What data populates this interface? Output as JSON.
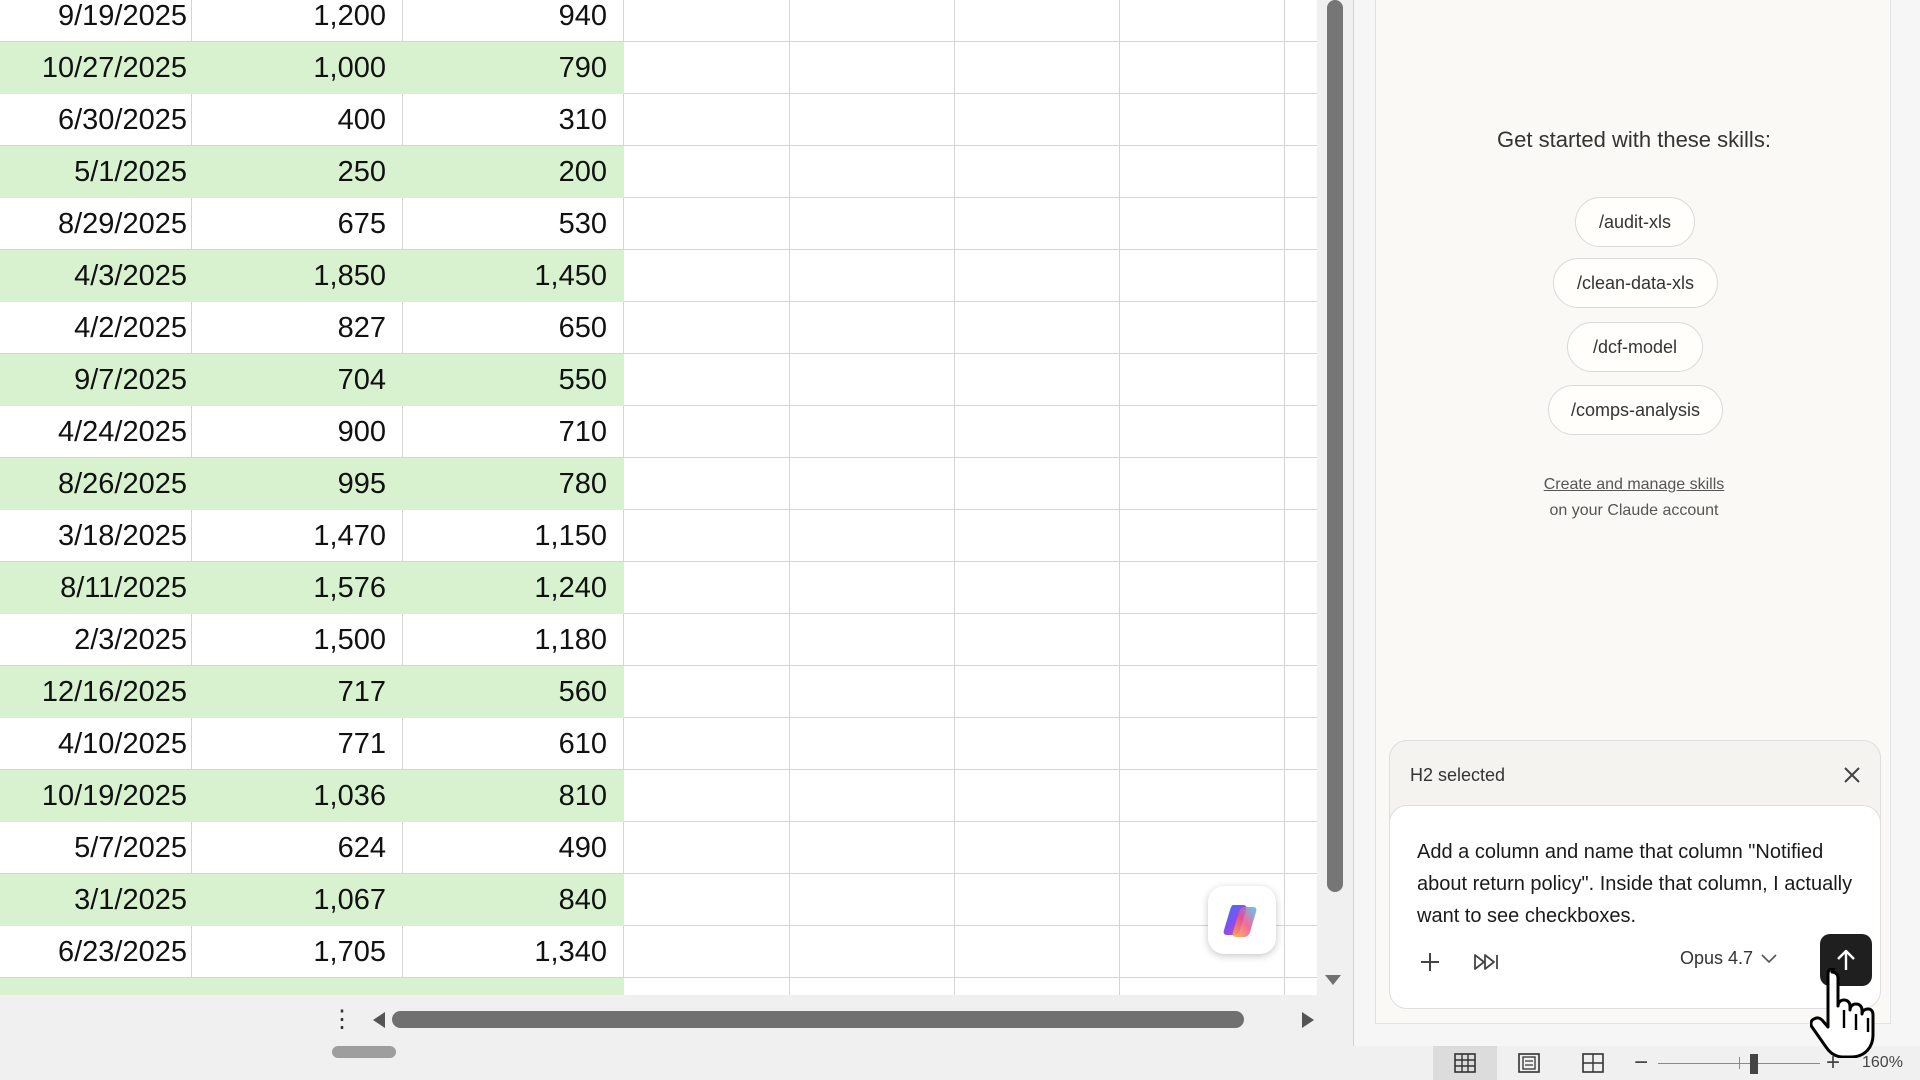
{
  "sheet": {
    "rows": [
      {
        "date": "9/19/2025",
        "col2": "1,200",
        "col3": "940",
        "green": false
      },
      {
        "date": "10/27/2025",
        "col2": "1,000",
        "col3": "790",
        "green": true
      },
      {
        "date": "6/30/2025",
        "col2": "400",
        "col3": "310",
        "green": false
      },
      {
        "date": "5/1/2025",
        "col2": "250",
        "col3": "200",
        "green": true
      },
      {
        "date": "8/29/2025",
        "col2": "675",
        "col3": "530",
        "green": false
      },
      {
        "date": "4/3/2025",
        "col2": "1,850",
        "col3": "1,450",
        "green": true
      },
      {
        "date": "4/2/2025",
        "col2": "827",
        "col3": "650",
        "green": false
      },
      {
        "date": "9/7/2025",
        "col2": "704",
        "col3": "550",
        "green": true
      },
      {
        "date": "4/24/2025",
        "col2": "900",
        "col3": "710",
        "green": false
      },
      {
        "date": "8/26/2025",
        "col2": "995",
        "col3": "780",
        "green": true
      },
      {
        "date": "3/18/2025",
        "col2": "1,470",
        "col3": "1,150",
        "green": false
      },
      {
        "date": "8/11/2025",
        "col2": "1,576",
        "col3": "1,240",
        "green": true
      },
      {
        "date": "2/3/2025",
        "col2": "1,500",
        "col3": "1,180",
        "green": false
      },
      {
        "date": "12/16/2025",
        "col2": "717",
        "col3": "560",
        "green": true
      },
      {
        "date": "4/10/2025",
        "col2": "771",
        "col3": "610",
        "green": false
      },
      {
        "date": "10/19/2025",
        "col2": "1,036",
        "col3": "810",
        "green": true
      },
      {
        "date": "5/7/2025",
        "col2": "624",
        "col3": "490",
        "green": false
      },
      {
        "date": "3/1/2025",
        "col2": "1,067",
        "col3": "840",
        "green": true
      },
      {
        "date": "6/23/2025",
        "col2": "1,705",
        "col3": "1,340",
        "green": false
      },
      {
        "date": "",
        "col2": "",
        "col3": "",
        "green": true
      }
    ],
    "row_fill_color": "#d8f2d0"
  },
  "status_bar": {
    "zoom_level": "160%",
    "view_modes": [
      "normal-view",
      "page-layout-view",
      "page-break-view"
    ]
  },
  "copilot": {
    "icon": "copilot-icon"
  },
  "panel": {
    "skills_heading": "Get started with these skills:",
    "skills": [
      "/audit-xls",
      "/clean-data-xls",
      "/dcf-model",
      "/comps-analysis"
    ],
    "manage_link": "Create and manage skills",
    "manage_sub": "on your Claude account",
    "composer": {
      "selection_label": "H2 selected",
      "prompt": "Add a column and name that column \"Notified about return policy\". Inside that column, I actually want to see checkboxes.",
      "model": "Opus 4.7"
    },
    "accent_send": "#1f1f1f"
  }
}
